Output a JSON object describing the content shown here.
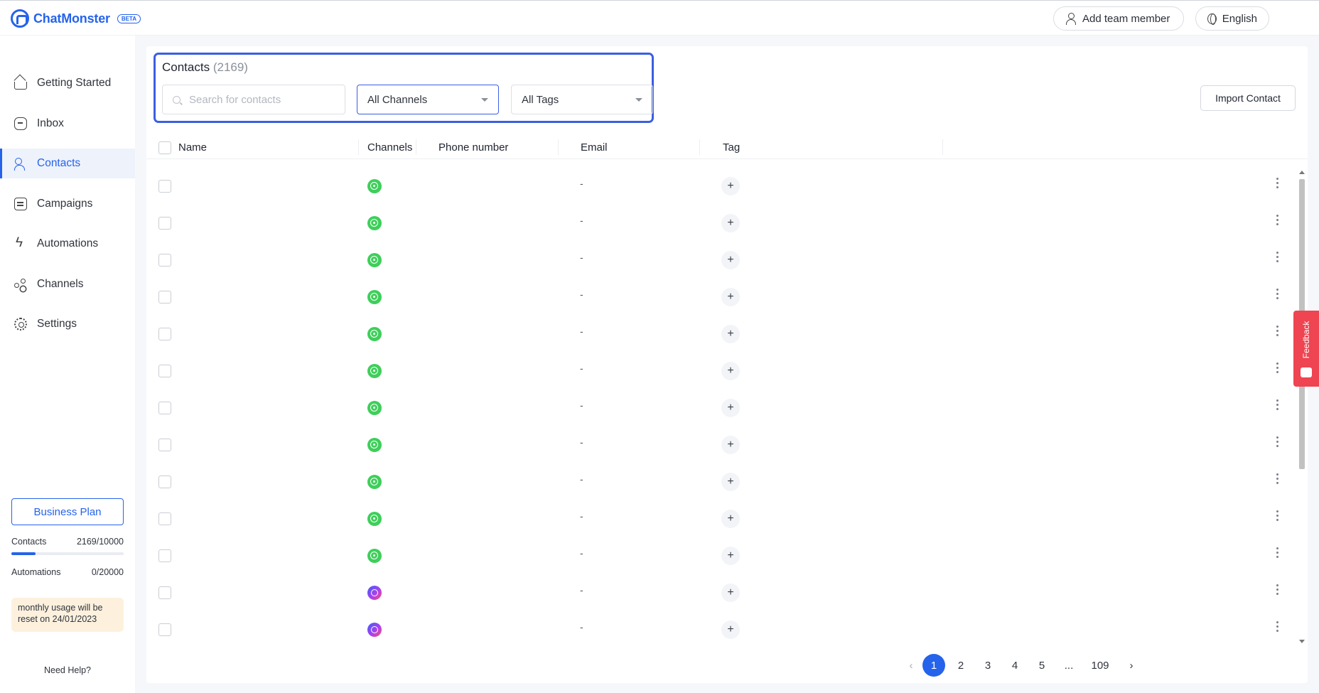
{
  "app": {
    "name": "ChatMonster",
    "badge": "BETA"
  },
  "topbar": {
    "add_team_member": "Add team member",
    "language": "English"
  },
  "sidebar": {
    "items": [
      {
        "label": "Getting Started",
        "icon": "home-icon"
      },
      {
        "label": "Inbox",
        "icon": "inbox-icon"
      },
      {
        "label": "Contacts",
        "icon": "contacts-icon",
        "active": true
      },
      {
        "label": "Campaigns",
        "icon": "campaigns-icon"
      },
      {
        "label": "Automations",
        "icon": "lightning-icon"
      },
      {
        "label": "Channels",
        "icon": "channels-icon"
      },
      {
        "label": "Settings",
        "icon": "gear-icon"
      }
    ],
    "plan_label": "Business Plan",
    "usage": [
      {
        "label": "Contacts",
        "value": "2169/10000",
        "fraction": 0.2169
      },
      {
        "label": "Automations",
        "value": "0/20000"
      }
    ],
    "reset_notice": "monthly usage will be reset on 24/01/2023",
    "help": "Need Help?"
  },
  "contacts": {
    "title": "Contacts",
    "count": "(2169)",
    "search_placeholder": "Search for contacts",
    "channel_filter": "All Channels",
    "tag_filter": "All Tags",
    "import_label": "Import Contact",
    "columns": {
      "name": "Name",
      "channels": "Channels",
      "phone": "Phone number",
      "email": "Email",
      "tag": "Tag"
    },
    "rows": [
      {
        "channel": "whatsapp",
        "email": "-"
      },
      {
        "channel": "whatsapp",
        "email": "-"
      },
      {
        "channel": "whatsapp",
        "email": "-"
      },
      {
        "channel": "whatsapp",
        "email": "-"
      },
      {
        "channel": "whatsapp",
        "email": "-"
      },
      {
        "channel": "whatsapp",
        "email": "-"
      },
      {
        "channel": "whatsapp",
        "email": "-"
      },
      {
        "channel": "whatsapp",
        "email": "-"
      },
      {
        "channel": "whatsapp",
        "email": "-"
      },
      {
        "channel": "whatsapp",
        "email": "-"
      },
      {
        "channel": "whatsapp",
        "email": "-"
      },
      {
        "channel": "messenger",
        "email": "-"
      },
      {
        "channel": "messenger",
        "email": "-"
      }
    ],
    "tag_add_symbol": "+"
  },
  "pagination": {
    "pages": [
      "1",
      "2",
      "3",
      "4",
      "5",
      "...",
      "109"
    ],
    "current": "1"
  },
  "feedback": {
    "label": "Feedback"
  },
  "colors": {
    "accent": "#2563eb",
    "whatsapp": "#3ecf5a",
    "feedback": "#ef4451"
  }
}
